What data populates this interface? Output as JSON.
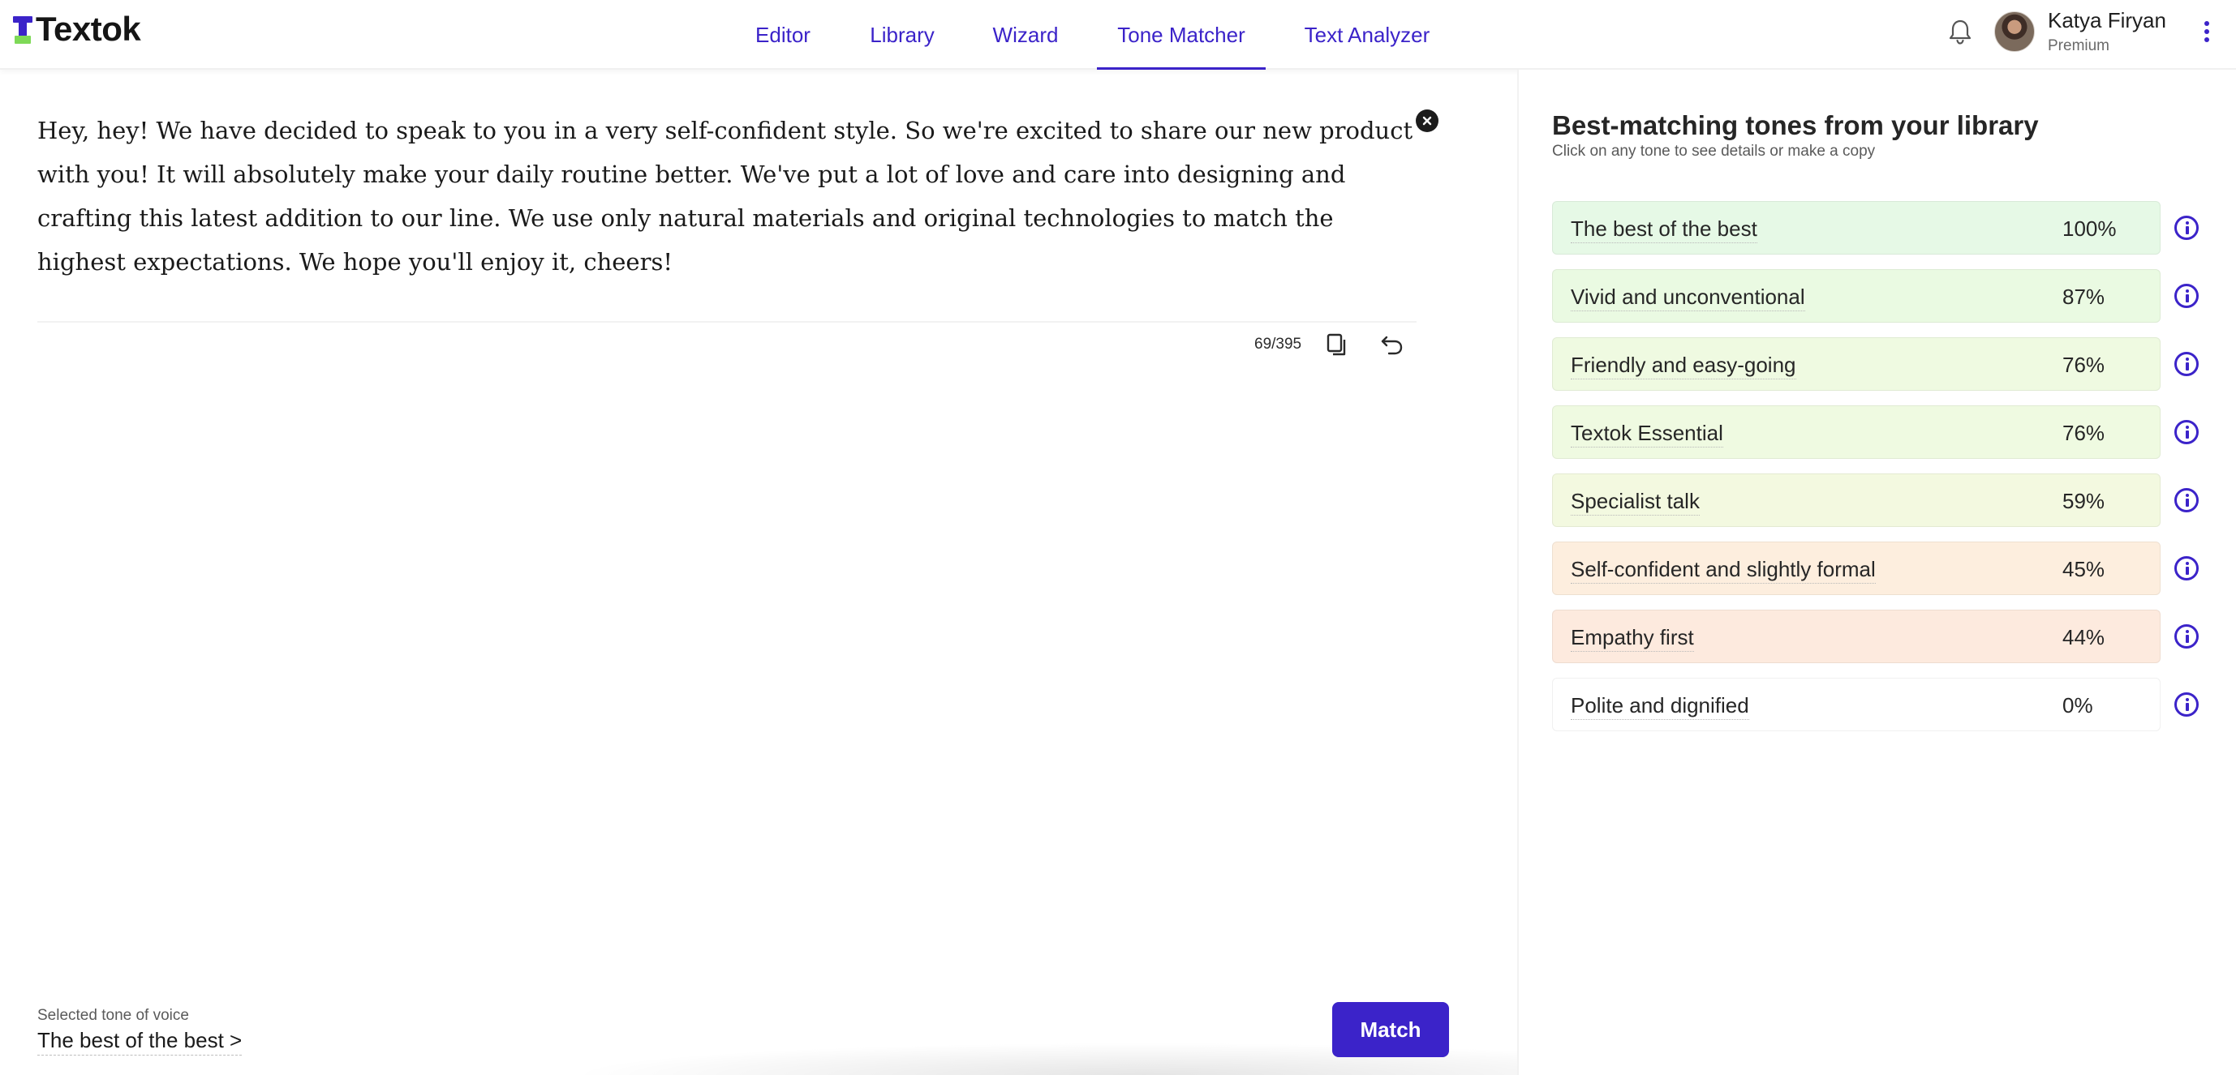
{
  "app": {
    "logo_text": "Textok",
    "colors": {
      "brand": "#3b23c9",
      "accent_green": "#7ed957"
    }
  },
  "nav": {
    "items": [
      {
        "label": "Editor",
        "active": false
      },
      {
        "label": "Library",
        "active": false
      },
      {
        "label": "Wizard",
        "active": false
      },
      {
        "label": "Tone Matcher",
        "active": true
      },
      {
        "label": "Text Analyzer",
        "active": false
      }
    ]
  },
  "user": {
    "name": "Katya Firyan",
    "plan": "Premium",
    "icons": [
      "bell-icon",
      "avatar",
      "more-vertical-icon"
    ]
  },
  "editor": {
    "text": "Hey, hey! We have decided to speak to you in a very self-confident style. So we're excited to share our new product with you! It will absolutely make your daily routine better. We've put a lot of love and care into designing and crafting this latest addition to our line. We use only natural materials and original technologies to match the highest expectations. We hope you'll enjoy it, cheers!",
    "counter": "69/395",
    "selected_label": "Selected tone of voice",
    "selected_value": "The best of the best >",
    "match_label": "Match"
  },
  "panel": {
    "title": "Best-matching tones from your library",
    "subtitle": "Click on any tone to see details or make a copy",
    "tones": [
      {
        "name": "The best of the best",
        "percent": "100%",
        "color": "#e6f9e6"
      },
      {
        "name": "Vivid and unconventional",
        "percent": "87%",
        "color": "#eafae2"
      },
      {
        "name": "Friendly and easy-going",
        "percent": "76%",
        "color": "#effae1"
      },
      {
        "name": "Textok Essential",
        "percent": "76%",
        "color": "#effae1"
      },
      {
        "name": "Specialist talk",
        "percent": "59%",
        "color": "#f3f9e0"
      },
      {
        "name": "Self-confident and slightly formal",
        "percent": "45%",
        "color": "#fdeede"
      },
      {
        "name": "Empathy first",
        "percent": "44%",
        "color": "#fdeade"
      },
      {
        "name": "Polite and dignified",
        "percent": "0%",
        "color": "#ffffff"
      }
    ]
  }
}
